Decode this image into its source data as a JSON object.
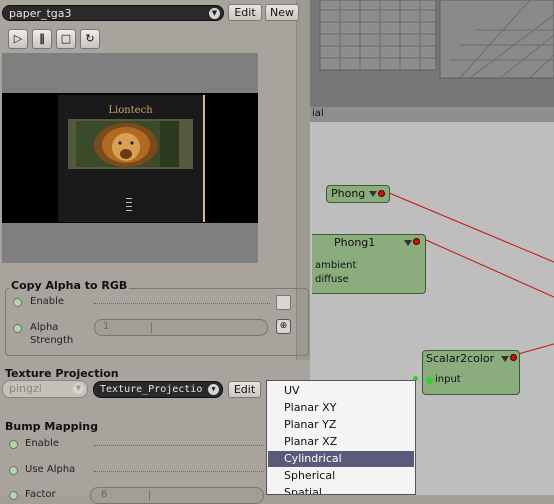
{
  "material": {
    "name": "paper_tga3",
    "edit_label": "Edit",
    "new_label": "New"
  },
  "player": {
    "play_icon": "play-icon",
    "pause_icon": "pause-icon",
    "stop_icon": "stop-icon",
    "loop_icon": "loop-icon"
  },
  "preview": {
    "title_text": "Liontech"
  },
  "copy_alpha": {
    "title": "Copy Alpha to RGB",
    "enable_label": "Enable",
    "alpha_strength_label1": "Alpha",
    "alpha_strength_label2": "Strength",
    "alpha_strength_value": "1"
  },
  "texture_projection": {
    "title": "Texture Projection",
    "name_value": "pingzi",
    "projection_value": "Texture_Projectio",
    "edit_label": "Edit"
  },
  "bump_mapping": {
    "title": "Bump Mapping",
    "enable_label": "Enable",
    "use_alpha_label": "Use Alpha",
    "factor_label": "Factor",
    "factor_value": "6"
  },
  "node_editor": {
    "header_text": "ial",
    "nodes": {
      "phong_small": "Phong",
      "phong1": "Phong1",
      "phong1_port1": "ambient",
      "phong1_port2": "diffuse",
      "scalar2color": "Scalar2color",
      "scalar2color_port": "input"
    }
  },
  "projection_menu": {
    "items": [
      "UV",
      "Planar XY",
      "Planar YZ",
      "Planar XZ",
      "Cylindrical",
      "Spherical",
      "Spatial"
    ],
    "selected": "Cylindrical"
  },
  "colors": {
    "node_green": "#8bad7e",
    "menu_selection": "#5a5a7a",
    "connection_red": "#cc1111"
  }
}
